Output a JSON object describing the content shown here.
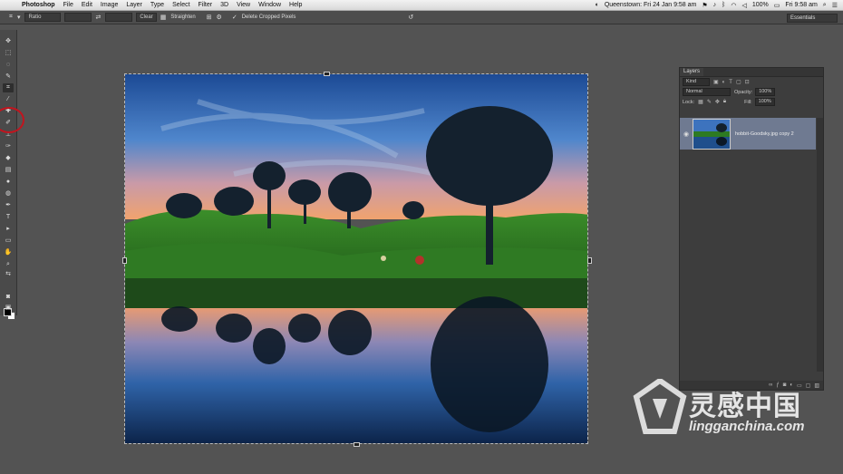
{
  "menubar": {
    "app_name": "Photoshop",
    "items": [
      "File",
      "Edit",
      "Image",
      "Layer",
      "Type",
      "Select",
      "Filter",
      "3D",
      "View",
      "Window",
      "Help"
    ],
    "clock_city": "Queenstown: Fri 24 Jan 9:58 am",
    "battery": "100%",
    "time": "Fri 9:58 am"
  },
  "options_bar": {
    "ratio_select": "Ratio",
    "clear_label": "Clear",
    "straighten_label": "Straighten",
    "delete_cropped_label": "Delete Cropped Pixels",
    "workspace": "Essentials"
  },
  "layers_panel": {
    "tab_label": "Layers",
    "kind_filter": "Kind",
    "blend_mode": "Normal",
    "opacity_label": "Opacity:",
    "opacity_value": "100%",
    "lock_label": "Lock:",
    "fill_label": "Fill:",
    "fill_value": "100%",
    "layer_name": "hobbit-Goodsky.jpg copy 2"
  },
  "watermark": {
    "cn_text": "灵感中国",
    "en_text": "lingganchina.com"
  },
  "colors": {
    "accent_circle": "#c2141e",
    "selected_layer": "#6f7a91",
    "sky_top": "#1e4f9b",
    "water": "#0e2b52"
  }
}
